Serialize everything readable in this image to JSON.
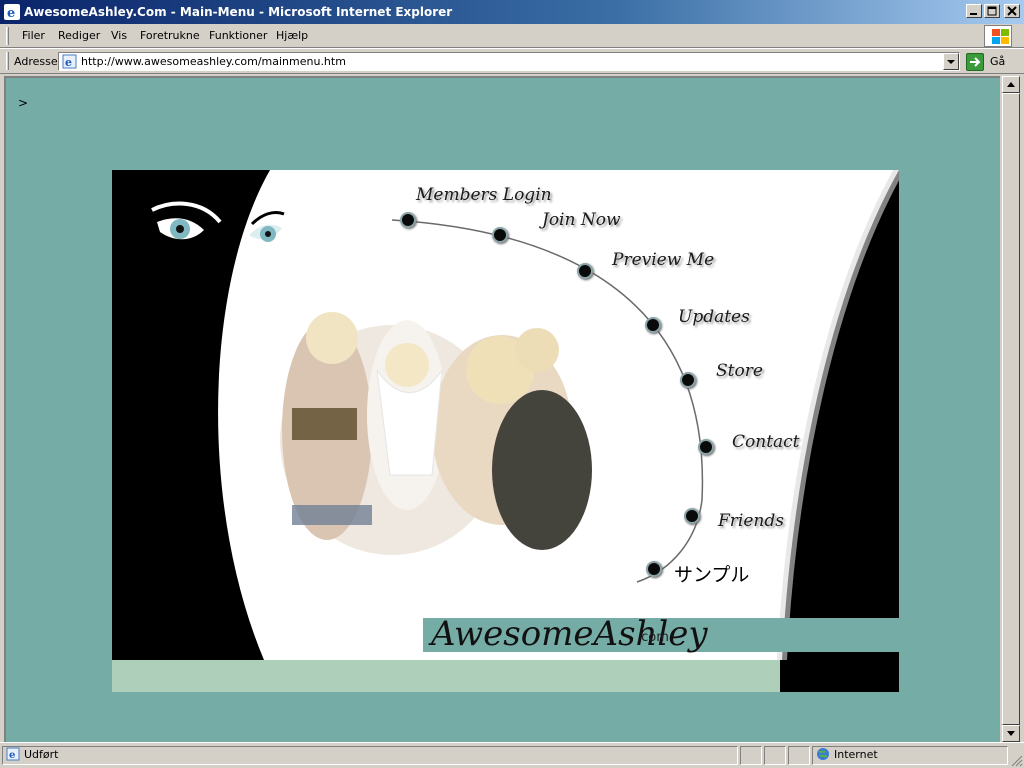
{
  "window": {
    "title": "AwesomeAshley.Com - Main-Menu - Microsoft Internet Explorer"
  },
  "menubar": {
    "items": [
      {
        "label": "Filer"
      },
      {
        "label": "Rediger"
      },
      {
        "label": "Vis"
      },
      {
        "label": "Foretrukne"
      },
      {
        "label": "Funktioner"
      },
      {
        "label": "Hjælp"
      }
    ]
  },
  "address_bar": {
    "label": "Adresse",
    "url": "http://www.awesomeashley.com/mainmenu.htm",
    "go_label": "Gå"
  },
  "page": {
    "stray_text": ">",
    "background_color": "#76aca6",
    "nav": [
      {
        "label": "Members Login"
      },
      {
        "label": "Join Now"
      },
      {
        "label": "Preview Me"
      },
      {
        "label": "Updates"
      },
      {
        "label": "Store"
      },
      {
        "label": "Contact"
      },
      {
        "label": "Friends"
      },
      {
        "label": "サンプル"
      }
    ],
    "brand": {
      "name": "AwesomeAshley",
      "suffix": ".com"
    },
    "bottom_strip_color": "#aecfba"
  },
  "statusbar": {
    "status": "Udført",
    "zone": "Internet"
  }
}
